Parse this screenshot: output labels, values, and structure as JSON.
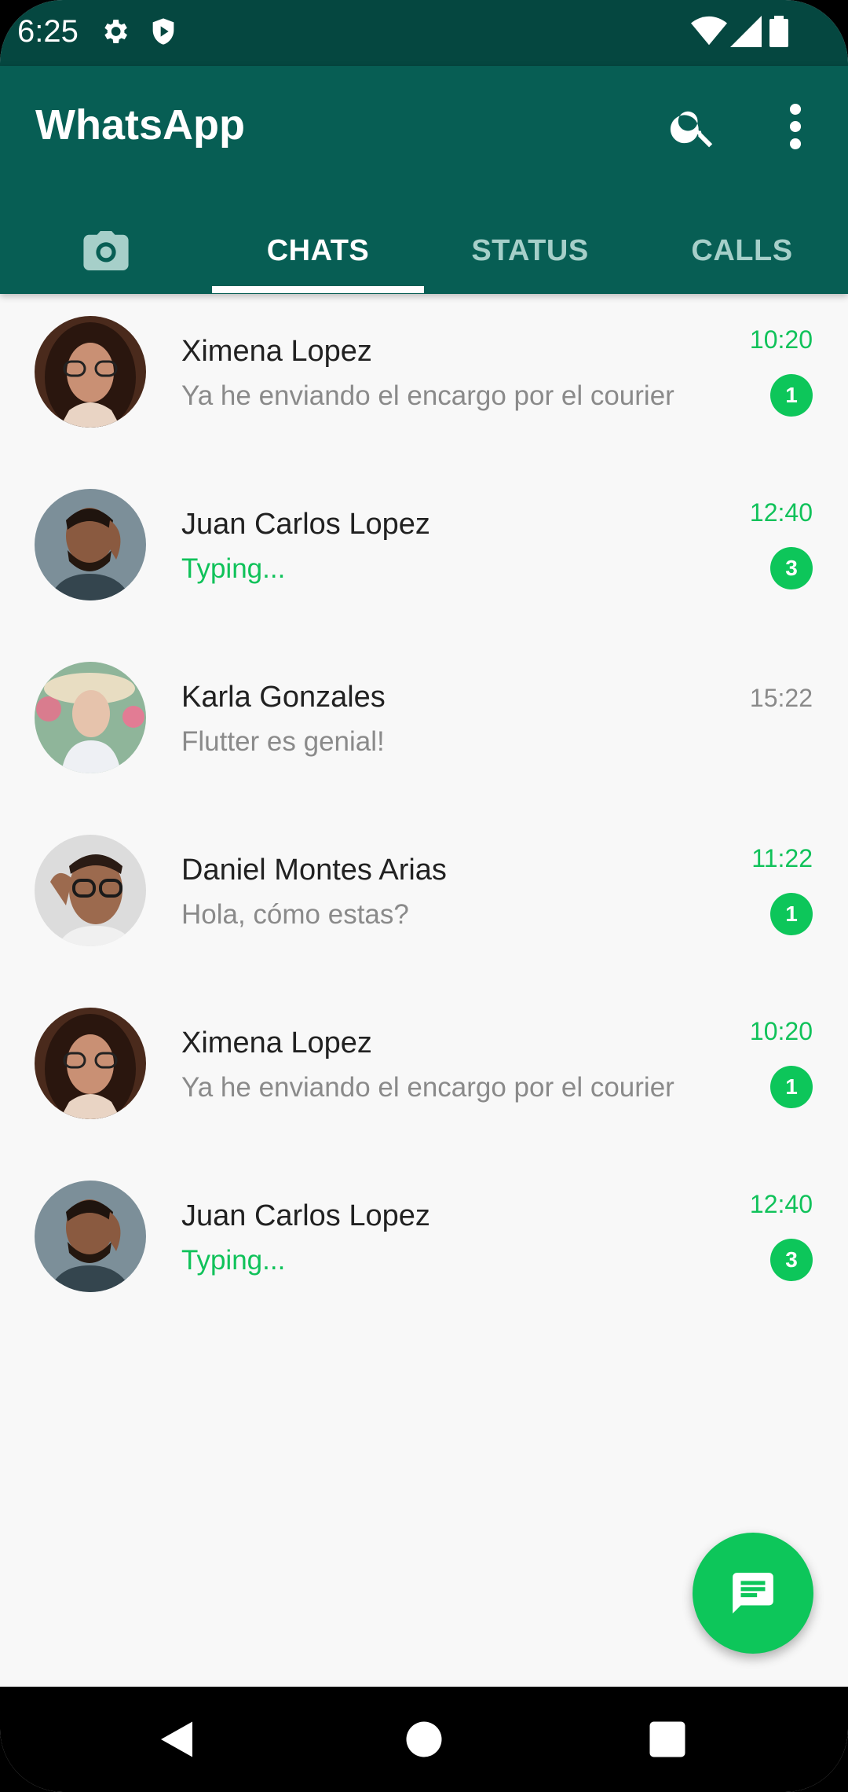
{
  "status_bar": {
    "time": "6:25",
    "icons": [
      "gear-icon",
      "shield-icon",
      "wifi-icon",
      "signal-icon",
      "battery-icon"
    ]
  },
  "app_bar": {
    "title": "WhatsApp",
    "background": "#075e54",
    "icons": [
      "search-icon",
      "more-vert-icon"
    ]
  },
  "tabs": [
    {
      "label": "",
      "icon": "camera-icon"
    },
    {
      "label": "CHATS",
      "active": true
    },
    {
      "label": "STATUS"
    },
    {
      "label": "CALLS"
    }
  ],
  "chats": [
    {
      "name": "Ximena Lopez",
      "message": "Ya he enviando el encargo por el courier",
      "time": "10:20",
      "unread": "1"
    },
    {
      "name": "Juan Carlos Lopez",
      "message": "Typing...",
      "time": "12:40",
      "unread": "3"
    },
    {
      "name": "Karla Gonzales",
      "message": "Flutter es genial!",
      "time": "15:22",
      "unread": ""
    },
    {
      "name": "Daniel Montes Arias",
      "message": "Hola, cómo estas?",
      "time": "11:22",
      "unread": "1"
    },
    {
      "name": "Ximena Lopez",
      "message": "Ya he enviando el encargo por el courier",
      "time": "10:20",
      "unread": "1"
    },
    {
      "name": "Juan Carlos Lopez",
      "message": "Typing...",
      "time": "12:40",
      "unread": "3"
    }
  ],
  "fab": {
    "icon": "message-icon",
    "color": "#0dc65a"
  },
  "nav_bar": {
    "icons": [
      "back-icon",
      "home-icon",
      "recents-icon"
    ]
  },
  "colors": {
    "accent": "#0dc65a",
    "header": "#075e54",
    "status_bar": "#054740"
  }
}
